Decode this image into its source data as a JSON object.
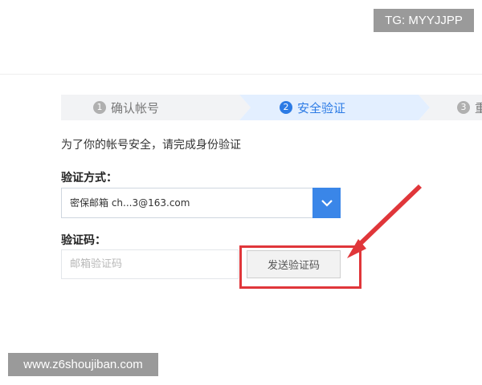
{
  "watermarks": {
    "top_right": "TG: MYYJJPP",
    "bottom_left": "www.z6shoujiban.com"
  },
  "steps": [
    {
      "number": "1",
      "label": "确认帐号",
      "state": "done"
    },
    {
      "number": "2",
      "label": "安全验证",
      "state": "active"
    },
    {
      "number": "3",
      "label": "重",
      "state": "pending"
    }
  ],
  "form": {
    "hint": "为了你的帐号安全，请完成身份验证",
    "method_label": "验证方式：",
    "method_value": "密保邮箱 ch...3@163.com",
    "code_label": "验证码：",
    "code_placeholder": "邮箱验证码",
    "send_button": "发送验证码"
  },
  "colors": {
    "accent": "#3a86e8",
    "active_step_bg": "#e3efff",
    "step_bg": "#f2f3f5",
    "highlight": "#e0363a"
  },
  "icons": {
    "dropdown": "chevron-down-icon",
    "annotation": "red-arrow"
  }
}
